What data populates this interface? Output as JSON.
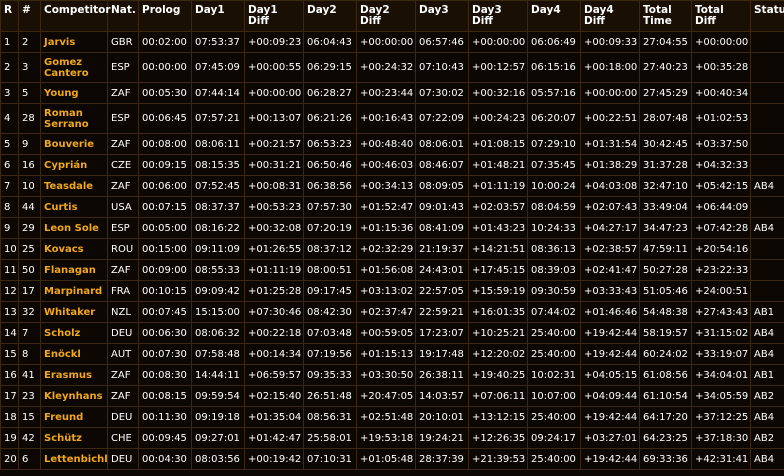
{
  "colors": {
    "background": "#0c0703",
    "grid": "#3a2810",
    "name": "#f0a818",
    "text": "#ffffff"
  },
  "headers": [
    "R",
    "#",
    "Competitor",
    "Nat.",
    "Prolog",
    "Day1",
    "Day1\nDiff",
    "Day2",
    "Day2\nDiff",
    "Day3",
    "Day3\nDiff",
    "Day4",
    "Day4\nDiff",
    "Total\nTime",
    "Total\nDiff",
    "Status"
  ],
  "rows": [
    [
      "1",
      "2",
      "Jarvis",
      "GBR",
      "00:02:00",
      "07:53:37",
      "+00:09:23",
      "06:04:43",
      "+00:00:00",
      "06:57:46",
      "+00:00:00",
      "06:06:49",
      "+00:09:33",
      "27:04:55",
      "+00:00:00",
      ""
    ],
    [
      "2",
      "3",
      "Gomez Cantero",
      "ESP",
      "00:00:00",
      "07:45:09",
      "+00:00:55",
      "06:29:15",
      "+00:24:32",
      "07:10:43",
      "+00:12:57",
      "06:15:16",
      "+00:18:00",
      "27:40:23",
      "+00:35:28",
      ""
    ],
    [
      "3",
      "5",
      "Young",
      "ZAF",
      "00:05:30",
      "07:44:14",
      "+00:00:00",
      "06:28:27",
      "+00:23:44",
      "07:30:02",
      "+00:32:16",
      "05:57:16",
      "+00:00:00",
      "27:45:29",
      "+00:40:34",
      ""
    ],
    [
      "4",
      "28",
      "Roman Serrano",
      "ESP",
      "00:06:45",
      "07:57:21",
      "+00:13:07",
      "06:21:26",
      "+00:16:43",
      "07:22:09",
      "+00:24:23",
      "06:20:07",
      "+00:22:51",
      "28:07:48",
      "+01:02:53",
      ""
    ],
    [
      "5",
      "9",
      "Bouverie",
      "ZAF",
      "00:08:00",
      "08:06:11",
      "+00:21:57",
      "06:53:23",
      "+00:48:40",
      "08:06:01",
      "+01:08:15",
      "07:29:10",
      "+01:31:54",
      "30:42:45",
      "+03:37:50",
      ""
    ],
    [
      "6",
      "16",
      "Cyprián",
      "CZE",
      "00:09:15",
      "08:15:35",
      "+00:31:21",
      "06:50:46",
      "+00:46:03",
      "08:46:07",
      "+01:48:21",
      "07:35:45",
      "+01:38:29",
      "31:37:28",
      "+04:32:33",
      ""
    ],
    [
      "7",
      "10",
      "Teasdale",
      "ZAF",
      "00:06:00",
      "07:52:45",
      "+00:08:31",
      "06:38:56",
      "+00:34:13",
      "08:09:05",
      "+01:11:19",
      "10:00:24",
      "+04:03:08",
      "32:47:10",
      "+05:42:15",
      "AB4"
    ],
    [
      "8",
      "44",
      "Curtis",
      "USA",
      "00:07:15",
      "08:37:37",
      "+00:53:23",
      "07:57:30",
      "+01:52:47",
      "09:01:43",
      "+02:03:57",
      "08:04:59",
      "+02:07:43",
      "33:49:04",
      "+06:44:09",
      ""
    ],
    [
      "9",
      "29",
      "Leon Sole",
      "ESP",
      "00:05:00",
      "08:16:22",
      "+00:32:08",
      "07:20:19",
      "+01:15:36",
      "08:41:09",
      "+01:43:23",
      "10:24:33",
      "+04:27:17",
      "34:47:23",
      "+07:42:28",
      "AB4"
    ],
    [
      "10",
      "25",
      "Kovacs",
      "ROU",
      "00:15:00",
      "09:11:09",
      "+01:26:55",
      "08:37:12",
      "+02:32:29",
      "21:19:37",
      "+14:21:51",
      "08:36:13",
      "+02:38:57",
      "47:59:11",
      "+20:54:16",
      ""
    ],
    [
      "11",
      "50",
      "Flanagan",
      "ZAF",
      "00:09:00",
      "08:55:33",
      "+01:11:19",
      "08:00:51",
      "+01:56:08",
      "24:43:01",
      "+17:45:15",
      "08:39:03",
      "+02:41:47",
      "50:27:28",
      "+23:22:33",
      ""
    ],
    [
      "12",
      "17",
      "Marpinard",
      "FRA",
      "00:10:15",
      "09:09:42",
      "+01:25:28",
      "09:17:45",
      "+03:13:02",
      "22:57:05",
      "+15:59:19",
      "09:30:59",
      "+03:33:43",
      "51:05:46",
      "+24:00:51",
      ""
    ],
    [
      "13",
      "32",
      "Whitaker",
      "NZL",
      "00:07:45",
      "15:15:00",
      "+07:30:46",
      "08:42:30",
      "+02:37:47",
      "22:59:21",
      "+16:01:35",
      "07:44:02",
      "+01:46:46",
      "54:48:38",
      "+27:43:43",
      "AB1"
    ],
    [
      "14",
      "7",
      "Scholz",
      "DEU",
      "00:06:30",
      "08:06:32",
      "+00:22:18",
      "07:03:48",
      "+00:59:05",
      "17:23:07",
      "+10:25:21",
      "25:40:00",
      "+19:42:44",
      "58:19:57",
      "+31:15:02",
      "AB4"
    ],
    [
      "15",
      "8",
      "Enöckl",
      "AUT",
      "00:07:30",
      "07:58:48",
      "+00:14:34",
      "07:19:56",
      "+01:15:13",
      "19:17:48",
      "+12:20:02",
      "25:40:00",
      "+19:42:44",
      "60:24:02",
      "+33:19:07",
      "AB4"
    ],
    [
      "16",
      "41",
      "Erasmus",
      "ZAF",
      "00:08:30",
      "14:44:11",
      "+06:59:57",
      "09:35:33",
      "+03:30:50",
      "26:38:11",
      "+19:40:25",
      "10:02:31",
      "+04:05:15",
      "61:08:56",
      "+34:04:01",
      "AB1"
    ],
    [
      "17",
      "23",
      "Kleynhans",
      "ZAF",
      "00:08:15",
      "09:59:54",
      "+02:15:40",
      "26:51:48",
      "+20:47:05",
      "14:03:57",
      "+07:06:11",
      "10:07:00",
      "+04:09:44",
      "61:10:54",
      "+34:05:59",
      "AB2"
    ],
    [
      "18",
      "15",
      "Freund",
      "DEU",
      "00:11:30",
      "09:19:18",
      "+01:35:04",
      "08:56:31",
      "+02:51:48",
      "20:10:01",
      "+13:12:15",
      "25:40:00",
      "+19:42:44",
      "64:17:20",
      "+37:12:25",
      "AB4"
    ],
    [
      "19",
      "42",
      "Schütz",
      "CHE",
      "00:09:45",
      "09:27:01",
      "+01:42:47",
      "25:58:01",
      "+19:53:18",
      "19:24:21",
      "+12:26:35",
      "09:24:17",
      "+03:27:01",
      "64:23:25",
      "+37:18:30",
      "AB2"
    ],
    [
      "20",
      "6",
      "Lettenbichler",
      "DEU",
      "00:04:30",
      "08:03:56",
      "+00:19:42",
      "07:10:31",
      "+01:05:48",
      "28:37:39",
      "+21:39:53",
      "25:40:00",
      "+19:42:44",
      "69:33:36",
      "+42:31:41",
      "AB4"
    ]
  ],
  "tall_rows": [
    1,
    3
  ]
}
